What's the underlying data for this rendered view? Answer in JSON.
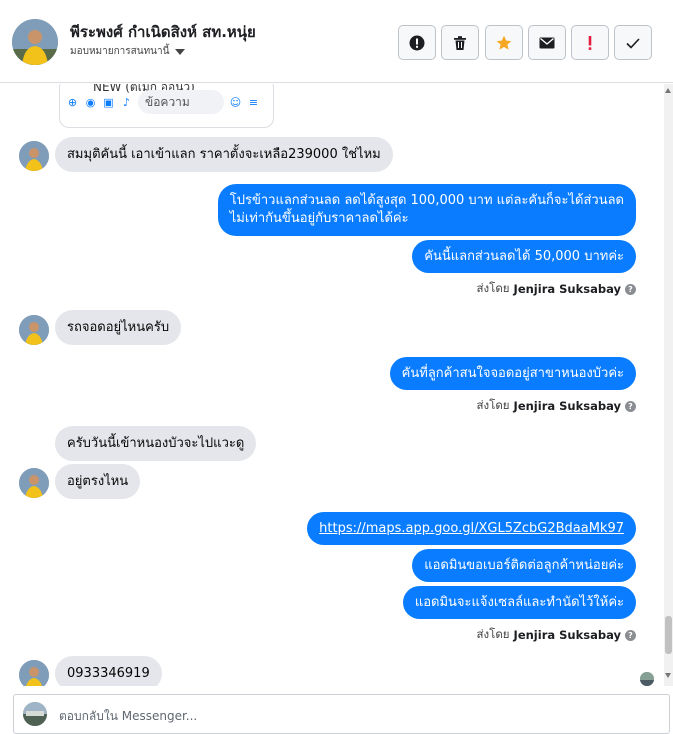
{
  "header": {
    "contact_name": "พีระพงศ์ กำเนิดสิงห์ สท.หนุ่ย",
    "assigned_label": "มอบหมายการสนทนานี้",
    "actions": [
      {
        "name": "spam-button",
        "icon": "exclamation-circle-icon"
      },
      {
        "name": "delete-button",
        "icon": "trash-icon"
      },
      {
        "name": "star-button",
        "icon": "star-icon"
      },
      {
        "name": "mark-unread-button",
        "icon": "envelope-icon"
      },
      {
        "name": "follow-up-button",
        "icon": "exclamation-icon"
      },
      {
        "name": "done-button",
        "icon": "check-icon"
      }
    ],
    "colors": {
      "star": "#f5a623",
      "follow_up": "#e41e3f"
    }
  },
  "thread": {
    "card": {
      "title": "NEW (ตีเม็ก ออนิว)",
      "input_placeholder": "ข้อความ"
    },
    "messages": [
      {
        "from": "customer",
        "text": "สมมุติคันนี้ เอาเข้าแลก ราคาตั้งจะเหลือ239000 ใช่ไหม"
      },
      {
        "from": "page",
        "text_line1": "โปรข้าวแลกส่วนลด ลดได้สูงสุด 100,000 บาท แต่ละคันก็จะได้ส่วนลด",
        "text_line2": "ไม่เท่ากันขึ้นอยู่กับราคาลดได้ค่ะ"
      },
      {
        "from": "page",
        "text": "คันนี้แลกส่วนลดได้ 50,000 บาทค่ะ"
      },
      {
        "from": "customer",
        "text": "รถจอดอยู่ไหนครับ"
      },
      {
        "from": "page",
        "text": "คันที่ลูกค้าสนใจจอดอยู่สาขาหนองบัวค่ะ"
      },
      {
        "from": "customer",
        "text": "ครับวันนี้เข้าหนองบัวจะไปแวะดู"
      },
      {
        "from": "customer",
        "text": "อยู่ตรงไหน"
      },
      {
        "from": "page",
        "text": "https://maps.app.goo.gl/XGL5ZcbG2BdaaMk97"
      },
      {
        "from": "page",
        "text": "แอดมินขอเบอร์ติดต่อลูกค้าหน่อยค่ะ"
      },
      {
        "from": "page",
        "text": "แอดมินจะแจ้งเซลล์และทำนัดไว้ให้ค่ะ"
      },
      {
        "from": "customer",
        "text": "0933346919"
      }
    ],
    "sent_by_prefix": "ส่งโดย",
    "sent_by_name": "Jenjira Suksabay"
  },
  "composer": {
    "placeholder": "ตอบกลับใน Messenger..."
  },
  "theme": {
    "outgoing_bubble": "#0a7cff",
    "incoming_bubble": "#e4e6eb"
  }
}
